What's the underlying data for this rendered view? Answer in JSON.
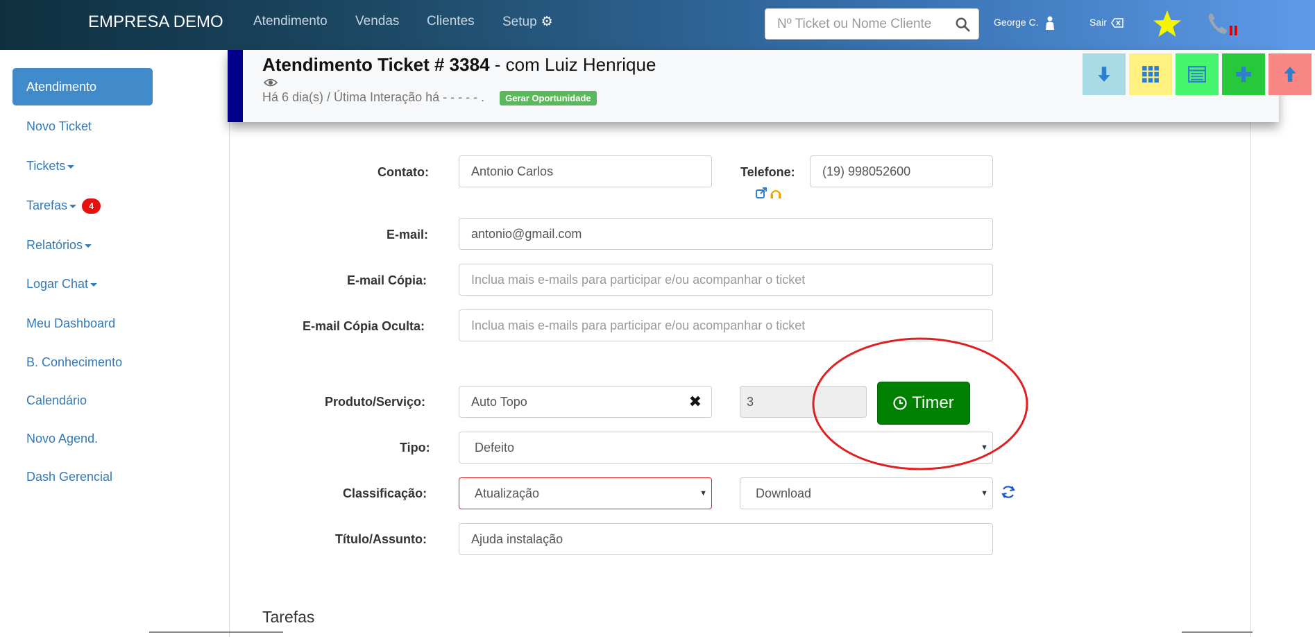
{
  "navbar": {
    "brand": "EMPRESA DEMO",
    "links": [
      "Atendimento",
      "Vendas",
      "Clientes",
      "Setup"
    ],
    "search_placeholder": "Nº Ticket ou Nome Cliente",
    "user": "George C.",
    "logout": "Sair"
  },
  "sidebar": {
    "items": [
      {
        "label": "Atendimento"
      },
      {
        "label": "Novo Ticket"
      },
      {
        "label": "Tickets"
      },
      {
        "label": "Tarefas",
        "badge": "4"
      },
      {
        "label": "Relatórios"
      },
      {
        "label": "Logar Chat"
      },
      {
        "label": "Meu Dashboard"
      },
      {
        "label": "B. Conhecimento"
      },
      {
        "label": "Calendário"
      },
      {
        "label": "Novo Agend."
      },
      {
        "label": "Dash Gerencial"
      }
    ]
  },
  "ticket": {
    "title_prefix": "Atendimento Ticket # 3384",
    "title_suffix": " - com Luiz Henrique",
    "subtitle": "Há 6 dia(s) / Útima Interação há - - - - - .",
    "opportunity_label": "Gerar Oportunidade"
  },
  "header_buttons": [
    {
      "name": "scroll-down-button",
      "color": "#a8dbe4",
      "icon": "arrow-down-icon"
    },
    {
      "name": "grid-button",
      "color": "#fff07f",
      "icon": "grid-icon"
    },
    {
      "name": "list-button",
      "color": "#46f56c",
      "icon": "list-icon"
    },
    {
      "name": "add-button",
      "color": "#27c93a",
      "icon": "plus-icon"
    },
    {
      "name": "scroll-up-button",
      "color": "#f98885",
      "icon": "arrow-up-icon"
    }
  ],
  "form": {
    "contato_label": "Contato:",
    "contato_value": "Antonio Carlos",
    "telefone_label": "Telefone:",
    "telefone_value": "(19) 998052600",
    "email_label": "E-mail:",
    "email_value": "antonio@gmail.com",
    "cc_label": "E-mail Cópia",
    "cc_colon": ":",
    "cc_placeholder": "Inclua mais e-mails para participar e/ou acompanhar o ticket",
    "bcc_label": "E-mail Cópia Oculta:",
    "bcc_placeholder": "Inclua mais e-mails para participar e/ou acompanhar o ticket",
    "produto_label": "Produto/Serviço:",
    "produto_value": "Auto Topo",
    "quantidade_value": "3",
    "timer_label": "Timer",
    "tipo_label": "Tipo:",
    "tipo_value": "Defeito",
    "classificacao_label": "Classificação:",
    "classificacao_value": "Atualização",
    "subclassificacao_value": "Download",
    "titulo_label": "Título/Assunto:",
    "titulo_value": "Ajuda instalação"
  },
  "section_title": "Tarefas",
  "colors": {
    "accent": "#428bca",
    "header_stripe": "#00008b",
    "timer_green": "#008000",
    "annotation_red": "#e02020"
  }
}
